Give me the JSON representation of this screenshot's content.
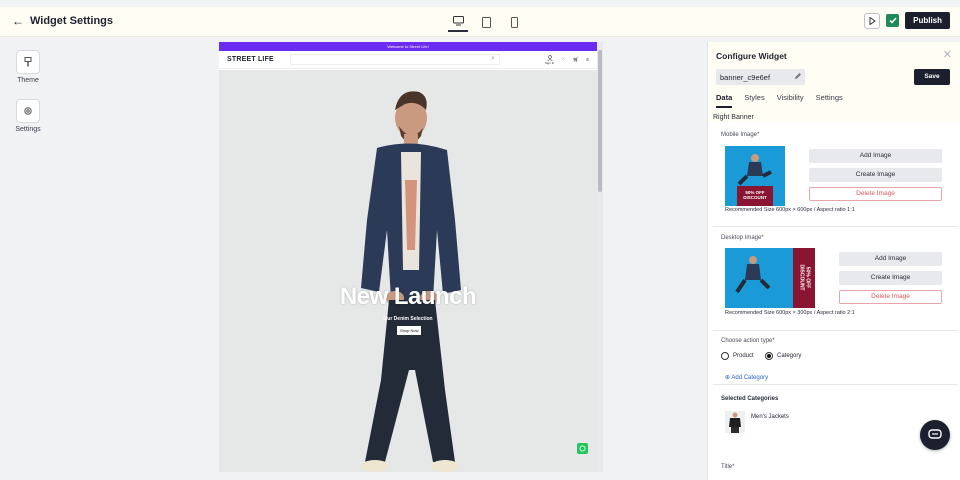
{
  "header": {
    "title": "Widget Settings",
    "publish_label": "Publish",
    "devices": [
      "desktop-icon",
      "tablet-icon",
      "mobile-icon"
    ]
  },
  "rail": {
    "items": [
      {
        "label": "Theme",
        "icon": "theme-icon"
      },
      {
        "label": "Settings",
        "icon": "gear-icon"
      }
    ]
  },
  "preview": {
    "announcement": "Welcome to Street Life!",
    "logo": "STREET LIFE",
    "signin": "Sign In",
    "hero_title": "New Launch",
    "hero_subtitle": "Our Denim Selection",
    "shop_now": "Shop Now"
  },
  "panel": {
    "title": "Configure Widget",
    "widget_id": "banner_c9e6ef",
    "save_label": "Save",
    "tabs": [
      "Data",
      "Styles",
      "Visibility",
      "Settings"
    ],
    "section_title": "Right Banner",
    "mobile_image": {
      "label": "Mobile Image*",
      "promo_line1": "50% OFF",
      "promo_line2": "DISCOUNT",
      "add": "Add Image",
      "create": "Create Image",
      "delete": "Delete Image",
      "recommended": "Recommended Size 600px × 600px / Aspect ratio 1:1"
    },
    "desktop_image": {
      "label": "Desktop Image*",
      "promo_line1": "50% OFF",
      "promo_line2": "DISCOUNT",
      "add": "Add Image",
      "create": "Create Image",
      "delete": "Delete Image",
      "recommended": "Recommended Size 600px × 300px / Aspect ratio 2:1"
    },
    "action": {
      "label": "Choose action type*",
      "options": [
        "Product",
        "Category"
      ],
      "selected": "Category",
      "add_category": "Add Category"
    },
    "selected_categories": {
      "label": "Selected Categories",
      "items": [
        "Men's Jackets"
      ]
    },
    "title_label": "Title*"
  },
  "colors": {
    "announce": "#6a2cf0",
    "primary_dark": "#1c1f2e",
    "danger": "#e05560",
    "banner_blue": "#1a9bd7",
    "banner_maroon": "#8a1532"
  }
}
